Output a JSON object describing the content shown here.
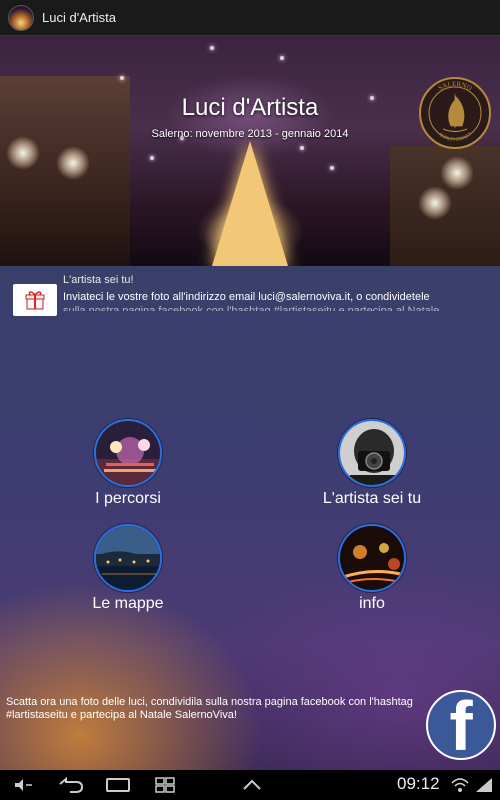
{
  "window": {
    "title": "Luci d'Artista"
  },
  "header": {
    "title": "Luci d'Artista",
    "subtitle": "Salerno: novembre 2013 - gennaio 2014",
    "logo": {
      "top": "SALERNO",
      "mid": "VIVA",
      "bottom": "AMALFI COAST"
    }
  },
  "news": {
    "title": "L'artista sei tu!",
    "text": "Inviateci le vostre foto all'indirizzo email luci@salernoviva.it, o condividetele",
    "text_more": "sulla nostra pagina facebook con l'hashtag #lartistaseitu e partecipa al Natale"
  },
  "menu": [
    {
      "label": "I percorsi",
      "icon": "percorsi-photo"
    },
    {
      "label": "L'artista sei tu",
      "icon": "camera-photo"
    },
    {
      "label": "Le mappe",
      "icon": "map-photo"
    },
    {
      "label": "info",
      "icon": "info-photo"
    }
  ],
  "footer": {
    "text": "Scatta ora una foto delle luci, condividila sulla nostra pagina facebook con l'hashtag #lartistaseitu e partecipa al Natale SalernoViva!",
    "facebook_letter": "f"
  },
  "statusbar": {
    "time": "09:12"
  },
  "colors": {
    "accent_ring": "#2a6fe0",
    "facebook": "#3b5998",
    "logo_gold": "#b58a3c"
  }
}
